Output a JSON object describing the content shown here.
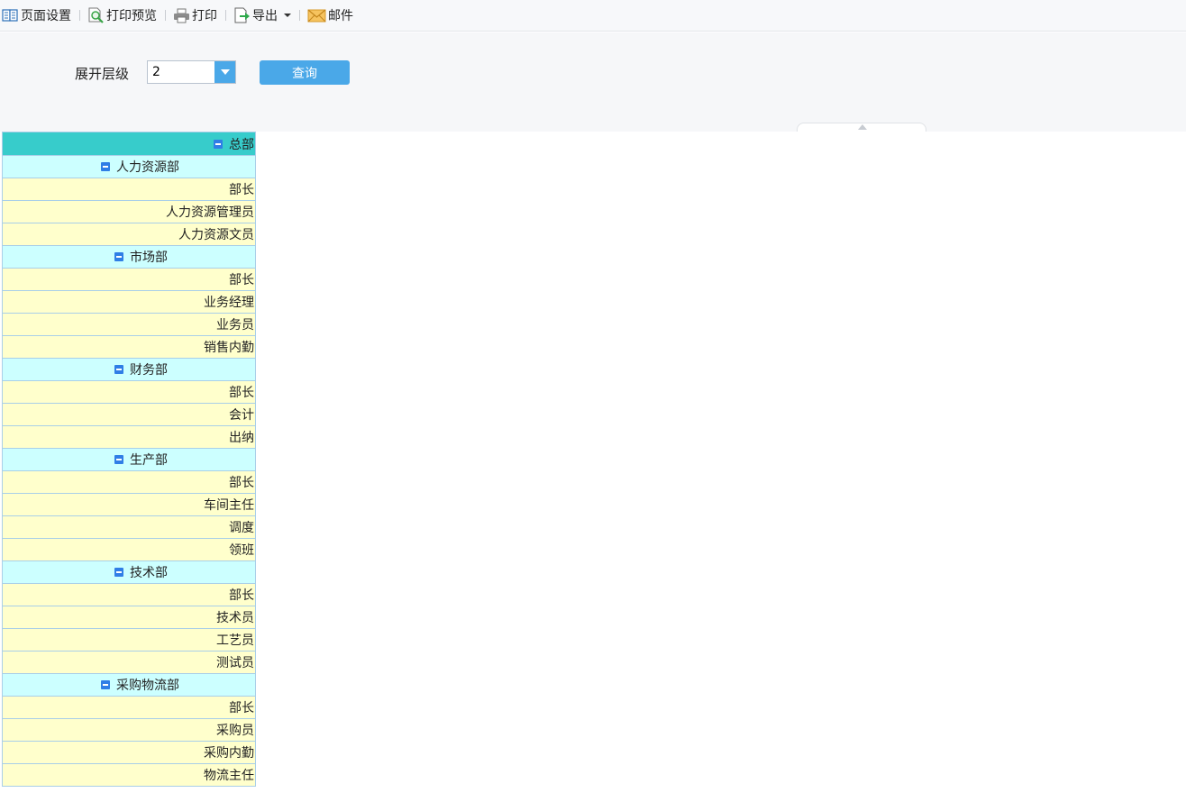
{
  "toolbar": {
    "page_setup": "页面设置",
    "print_preview": "打印预览",
    "print": "打印",
    "export": "导出",
    "mail": "邮件"
  },
  "params": {
    "expand_level_label": "展开层级",
    "expand_level_value": "2",
    "query_button": "查询"
  },
  "report": {
    "root": "总部",
    "departments": [
      {
        "name": "人力资源部",
        "positions": [
          "部长",
          "人力资源管理员",
          "人力资源文员"
        ]
      },
      {
        "name": "市场部",
        "positions": [
          "部长",
          "业务经理",
          "业务员",
          "销售内勤"
        ]
      },
      {
        "name": "财务部",
        "positions": [
          "部长",
          "会计",
          "出纳"
        ]
      },
      {
        "name": "生产部",
        "positions": [
          "部长",
          "车间主任",
          "调度",
          "领班"
        ]
      },
      {
        "name": "技术部",
        "positions": [
          "部长",
          "技术员",
          "工艺员",
          "测试员"
        ]
      },
      {
        "name": "采购物流部",
        "positions": [
          "部长",
          "采购员",
          "采购内勤",
          "物流主任"
        ]
      }
    ]
  },
  "colors": {
    "root_bg": "#37cccb",
    "dept_bg": "#ccffff",
    "position_bg": "#ffffcc",
    "accent": "#4aa8e8",
    "tree_toggle": "#2f7ee6"
  }
}
